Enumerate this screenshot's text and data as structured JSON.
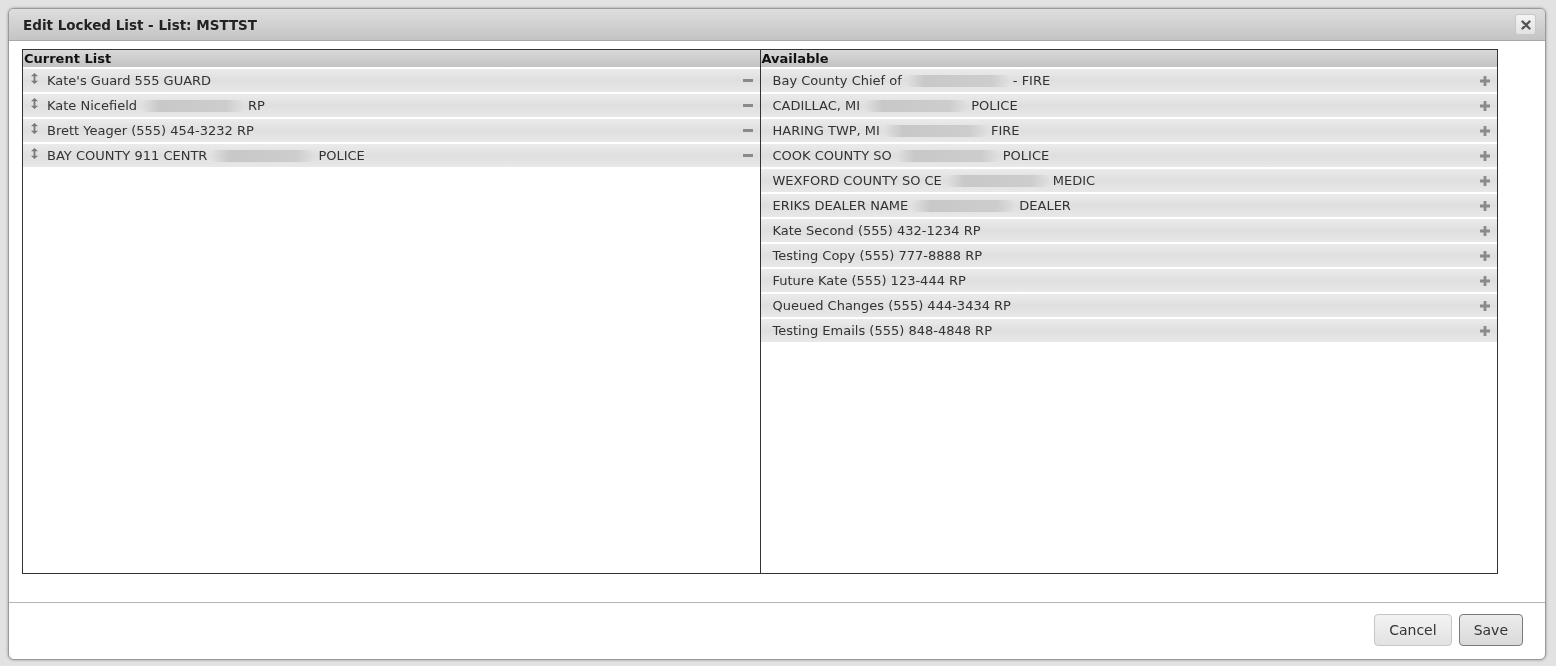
{
  "dialog": {
    "title": "Edit Locked List - List: MSTTST"
  },
  "current_list": {
    "heading": "Current List",
    "items": [
      {
        "text": "Kate's Guard 555 GUARD",
        "redacted": false
      },
      {
        "text": "Kate Nicefield",
        "redacted": true,
        "suffix": "RP"
      },
      {
        "text": "Brett Yeager (555) 454-3232 RP",
        "redacted": false
      },
      {
        "text": "BAY COUNTY 911 CENTR",
        "redacted": true,
        "suffix": "POLICE"
      }
    ]
  },
  "available": {
    "heading": "Available",
    "items": [
      {
        "text": "Bay County Chief of",
        "redacted": true,
        "suffix": "- FIRE"
      },
      {
        "text": "CADILLAC, MI",
        "redacted": true,
        "suffix": "POLICE"
      },
      {
        "text": "HARING TWP, MI",
        "redacted": true,
        "suffix": "FIRE"
      },
      {
        "text": "COOK COUNTY SO",
        "redacted": true,
        "suffix": "POLICE"
      },
      {
        "text": "WEXFORD COUNTY SO CE",
        "redacted": true,
        "suffix": "MEDIC"
      },
      {
        "text": "ERIKS DEALER NAME",
        "redacted": true,
        "suffix": "DEALER"
      },
      {
        "text": "Kate Second (555) 432-1234 RP",
        "redacted": false
      },
      {
        "text": "Testing Copy (555) 777-8888 RP",
        "redacted": false
      },
      {
        "text": "Future Kate (555) 123-444 RP",
        "redacted": false
      },
      {
        "text": "Queued Changes (555) 444-3434 RP",
        "redacted": false
      },
      {
        "text": "Testing Emails (555) 848-4848 RP",
        "redacted": false
      }
    ]
  },
  "buttons": [
    {
      "label": "Cancel",
      "default": false
    },
    {
      "label": "Save",
      "default": true
    }
  ]
}
